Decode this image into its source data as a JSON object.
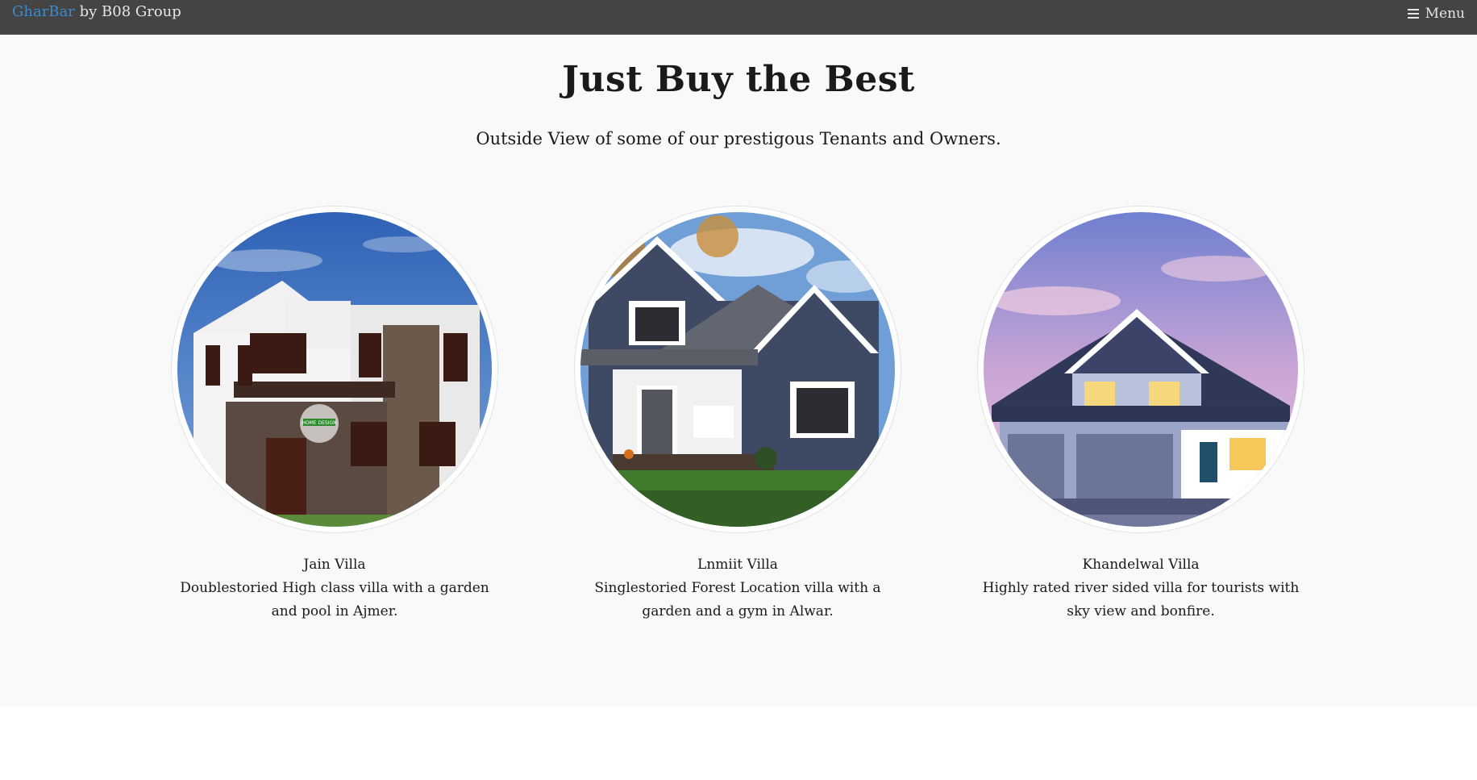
{
  "navbar": {
    "brand_name": "GharBar",
    "brand_suffix": " by B08 Group",
    "menu_label": "Menu",
    "menu_icon": "hamburger-icon"
  },
  "section": {
    "title": "Just Buy the Best",
    "subtitle": "Outside View of some of our prestigous Tenants and Owners."
  },
  "villas": [
    {
      "name": "Jain Villa",
      "description": "Doublestoried High class villa with a garden and pool in Ajmer.",
      "badge_text": "HOME DESIGN"
    },
    {
      "name": "Lnmiit Villa",
      "description": "Singlestoried Forest Location villa with a garden and a gym in Alwar."
    },
    {
      "name": "Khandelwal Villa",
      "description": "Highly rated river sided villa for tourists with sky view and bonfire."
    }
  ],
  "colors": {
    "navbar_bg": "#444444",
    "brand_accent": "#3a8cd0",
    "section_bg": "#f9f9f9"
  }
}
